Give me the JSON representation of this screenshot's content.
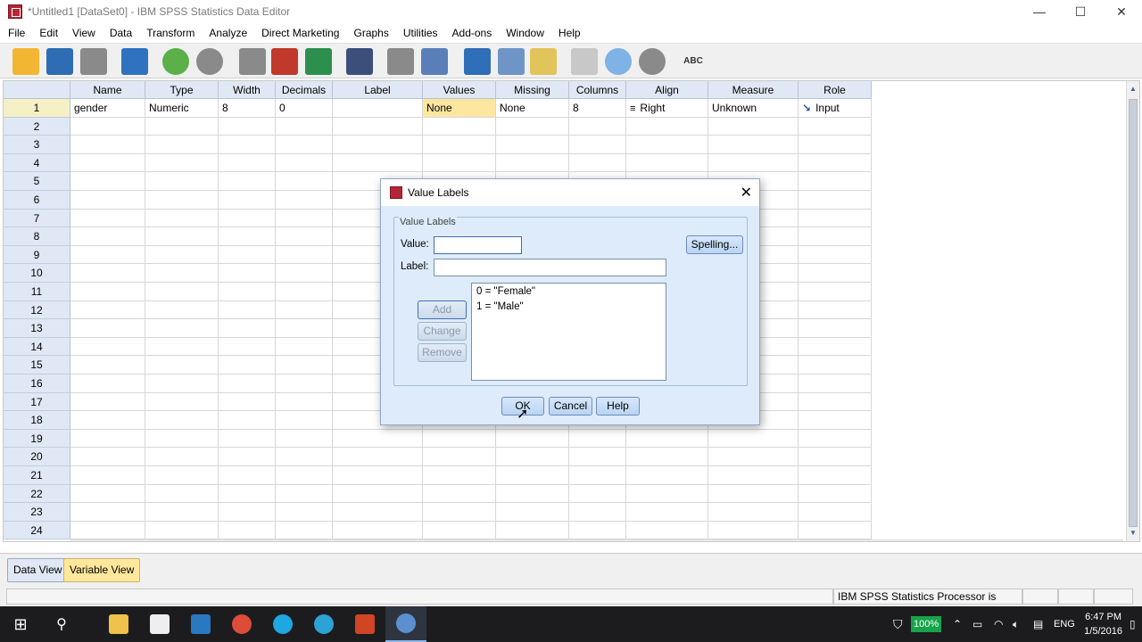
{
  "window": {
    "title": "*Untitled1 [DataSet0] - IBM SPSS Statistics Data Editor",
    "minimize": "—",
    "maximize": "☐",
    "close": "✕"
  },
  "menu": [
    "File",
    "Edit",
    "View",
    "Data",
    "Transform",
    "Analyze",
    "Direct Marketing",
    "Graphs",
    "Utilities",
    "Add-ons",
    "Window",
    "Help"
  ],
  "toolbar": {
    "icons": [
      "open-folder-icon",
      "save-icon",
      "print-icon",
      "recall-dialog-icon",
      "undo-icon",
      "redo-icon",
      "goto-case-icon",
      "goto-variable-icon",
      "variables-icon",
      "find-icon",
      "insert-cases-icon",
      "insert-variable-icon",
      "split-file-icon",
      "weight-cases-icon",
      "select-cases-icon",
      "value-labels-icon",
      "use-sets-icon",
      "show-all-icon",
      "spell-check-icon"
    ],
    "spell_label": "ABC"
  },
  "grid": {
    "columns": [
      "Name",
      "Type",
      "Width",
      "Decimals",
      "Label",
      "Values",
      "Missing",
      "Columns",
      "Align",
      "Measure",
      "Role"
    ],
    "rows": [
      "1",
      "2",
      "3",
      "4",
      "5",
      "6",
      "7",
      "8",
      "9",
      "10",
      "11",
      "12",
      "13",
      "14",
      "15",
      "16",
      "17",
      "18",
      "19",
      "20",
      "21",
      "22",
      "23",
      "24"
    ],
    "row1": {
      "name": "gender",
      "type": "Numeric",
      "width": "8",
      "decimals": "0",
      "label": "",
      "values": "None",
      "missing": "None",
      "columns": "8",
      "align": "Right",
      "measure": "Unknown",
      "role": "Input"
    }
  },
  "dialog": {
    "title": "Value Labels",
    "close": "✕",
    "group_label": "Value Labels",
    "value_label": "Value:",
    "value_input": "",
    "label_label": "Label:",
    "label_input": "",
    "spelling_button": "Spelling...",
    "add_button": "Add",
    "change_button": "Change",
    "remove_button": "Remove",
    "list": [
      "0 = \"Female\"",
      "1 = \"Male\""
    ],
    "ok_button": "OK",
    "cancel_button": "Cancel",
    "help_button": "Help"
  },
  "tabs": {
    "data_view": "Data View",
    "variable_view": "Variable View"
  },
  "status": {
    "processor": "IBM SPSS Statistics Processor is ready"
  },
  "taskbar": {
    "battery": "100%",
    "language": "ENG",
    "time": "6:47 PM",
    "date": "1/5/2016"
  }
}
